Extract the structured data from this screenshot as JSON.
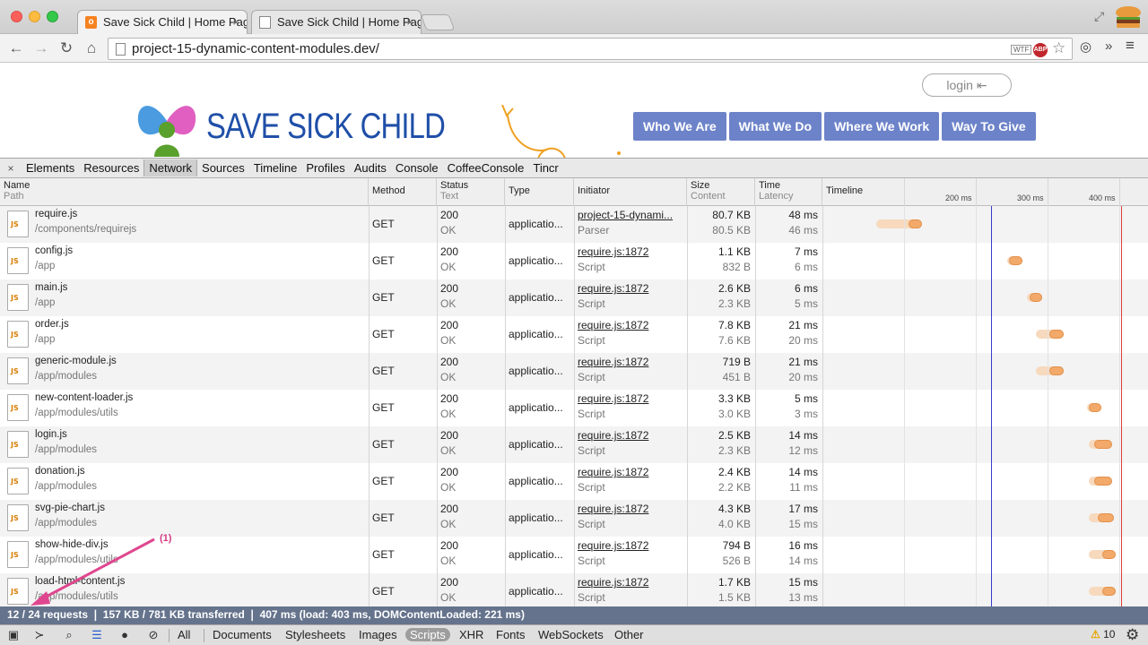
{
  "browser": {
    "tabs": [
      {
        "title": "Save Sick Child | Home Pag",
        "favicon": "orange-page-icon",
        "active": true
      },
      {
        "title": "Save Sick Child | Home Pag",
        "favicon": "blank-page-icon",
        "active": false
      }
    ],
    "url": "project-15-dynamic-content-modules.dev/",
    "extensions": {
      "wtf": "WTF",
      "abp": "ABP"
    }
  },
  "page": {
    "logo_text": "SAVE SICK CHILD",
    "login_label": "login",
    "nav": [
      "Who We Are",
      "What We Do",
      "Where We Work",
      "Way To Give"
    ]
  },
  "devtools": {
    "tabs": [
      "Elements",
      "Resources",
      "Network",
      "Sources",
      "Timeline",
      "Profiles",
      "Audits",
      "Console",
      "CoffeeConsole",
      "Tincr"
    ],
    "selected_tab": "Network",
    "columns": {
      "name": "Name",
      "path": "Path",
      "method": "Method",
      "status": "Status",
      "text": "Text",
      "type": "Type",
      "initiator": "Initiator",
      "size": "Size",
      "content": "Content",
      "time": "Time",
      "latency": "Latency",
      "timeline": "Timeline"
    },
    "ticks": [
      "200 ms",
      "300 ms",
      "400 ms"
    ],
    "rows": [
      {
        "name": "require.js",
        "path": "/components/requirejs",
        "method": "GET",
        "status": "200",
        "text": "OK",
        "type": "applicatio...",
        "initiator": "project-15-dynami...",
        "initiator_type": "Parser",
        "size": "80.7 KB",
        "content": "80.5 KB",
        "time": "48 ms",
        "latency": "46 ms"
      },
      {
        "name": "config.js",
        "path": "/app",
        "method": "GET",
        "status": "200",
        "text": "OK",
        "type": "applicatio...",
        "initiator": "require.js:1872",
        "initiator_type": "Script",
        "size": "1.1 KB",
        "content": "832 B",
        "time": "7 ms",
        "latency": "6 ms"
      },
      {
        "name": "main.js",
        "path": "/app",
        "method": "GET",
        "status": "200",
        "text": "OK",
        "type": "applicatio...",
        "initiator": "require.js:1872",
        "initiator_type": "Script",
        "size": "2.6 KB",
        "content": "2.3 KB",
        "time": "6 ms",
        "latency": "5 ms"
      },
      {
        "name": "order.js",
        "path": "/app",
        "method": "GET",
        "status": "200",
        "text": "OK",
        "type": "applicatio...",
        "initiator": "require.js:1872",
        "initiator_type": "Script",
        "size": "7.8 KB",
        "content": "7.6 KB",
        "time": "21 ms",
        "latency": "20 ms"
      },
      {
        "name": "generic-module.js",
        "path": "/app/modules",
        "method": "GET",
        "status": "200",
        "text": "OK",
        "type": "applicatio...",
        "initiator": "require.js:1872",
        "initiator_type": "Script",
        "size": "719 B",
        "content": "451 B",
        "time": "21 ms",
        "latency": "20 ms"
      },
      {
        "name": "new-content-loader.js",
        "path": "/app/modules/utils",
        "method": "GET",
        "status": "200",
        "text": "OK",
        "type": "applicatio...",
        "initiator": "require.js:1872",
        "initiator_type": "Script",
        "size": "3.3 KB",
        "content": "3.0 KB",
        "time": "5 ms",
        "latency": "3 ms"
      },
      {
        "name": "login.js",
        "path": "/app/modules",
        "method": "GET",
        "status": "200",
        "text": "OK",
        "type": "applicatio...",
        "initiator": "require.js:1872",
        "initiator_type": "Script",
        "size": "2.5 KB",
        "content": "2.3 KB",
        "time": "14 ms",
        "latency": "12 ms"
      },
      {
        "name": "donation.js",
        "path": "/app/modules",
        "method": "GET",
        "status": "200",
        "text": "OK",
        "type": "applicatio...",
        "initiator": "require.js:1872",
        "initiator_type": "Script",
        "size": "2.4 KB",
        "content": "2.2 KB",
        "time": "14 ms",
        "latency": "11 ms"
      },
      {
        "name": "svg-pie-chart.js",
        "path": "/app/modules",
        "method": "GET",
        "status": "200",
        "text": "OK",
        "type": "applicatio...",
        "initiator": "require.js:1872",
        "initiator_type": "Script",
        "size": "4.3 KB",
        "content": "4.0 KB",
        "time": "17 ms",
        "latency": "15 ms"
      },
      {
        "name": "show-hide-div.js",
        "path": "/app/modules/utils",
        "method": "GET",
        "status": "200",
        "text": "OK",
        "type": "applicatio...",
        "initiator": "require.js:1872",
        "initiator_type": "Script",
        "size": "794 B",
        "content": "526 B",
        "time": "16 ms",
        "latency": "14 ms"
      },
      {
        "name": "load-html-content.js",
        "path": "/app/modules/utils",
        "method": "GET",
        "status": "200",
        "text": "OK",
        "type": "applicatio...",
        "initiator": "require.js:1872",
        "initiator_type": "Script",
        "size": "1.7 KB",
        "content": "1.5 KB",
        "time": "15 ms",
        "latency": "13 ms"
      }
    ],
    "summary": "12 / 24 requests  ❘  157 KB / 781 KB transferred  ❘  407 ms (load: 403 ms, DOMContentLoaded: 221 ms)",
    "filters": [
      "All",
      "Documents",
      "Stylesheets",
      "Images",
      "Scripts",
      "XHR",
      "Fonts",
      "WebSockets",
      "Other"
    ],
    "selected_filter": "Scripts",
    "warning_count": "10",
    "annotation": "(1)"
  },
  "colors": {
    "nav_button": "#6d83c9",
    "logo_text": "#1f4fa8",
    "summary_bar": "#65738c",
    "load_line": "#e0403a",
    "domcontent_line": "#3a3ad0",
    "bar": "#f2a969"
  }
}
